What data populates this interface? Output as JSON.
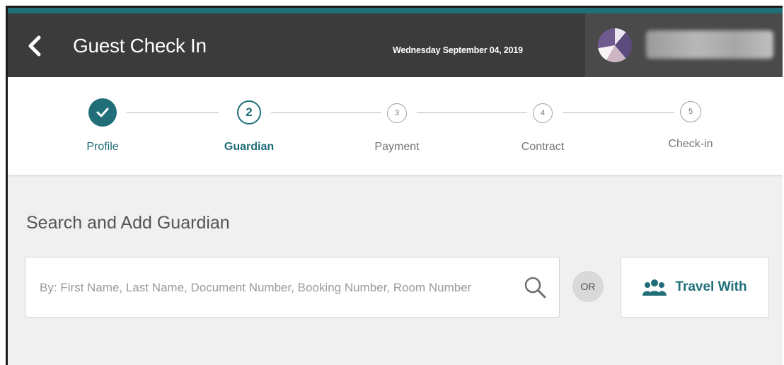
{
  "header": {
    "title": "Guest Check In",
    "date": "Wednesday September 04, 2019",
    "back_icon": "chevron-left-icon",
    "user_name": ""
  },
  "stepper": {
    "current_step": 2,
    "steps": [
      {
        "number": "✓",
        "label": "Profile",
        "state": "done"
      },
      {
        "number": "2",
        "label": "Guardian",
        "state": "active"
      },
      {
        "number": "3",
        "label": "Payment",
        "state": "pending"
      },
      {
        "number": "4",
        "label": "Contract",
        "state": "pending"
      },
      {
        "number": "5",
        "label": "Check-in",
        "state": "pending"
      }
    ]
  },
  "main": {
    "section_title": "Search and Add Guardian",
    "search": {
      "placeholder": "By: First Name, Last Name, Document Number, Booking Number, Room Number",
      "value": "",
      "icon": "search-icon"
    },
    "or_label": "OR",
    "travel_with": {
      "label": "Travel With",
      "icon": "group-icon"
    }
  },
  "colors": {
    "accent": "#1f6e78",
    "header_bg": "#3b3b3b",
    "page_bg": "#f0f0f0",
    "muted_text": "#777777"
  }
}
